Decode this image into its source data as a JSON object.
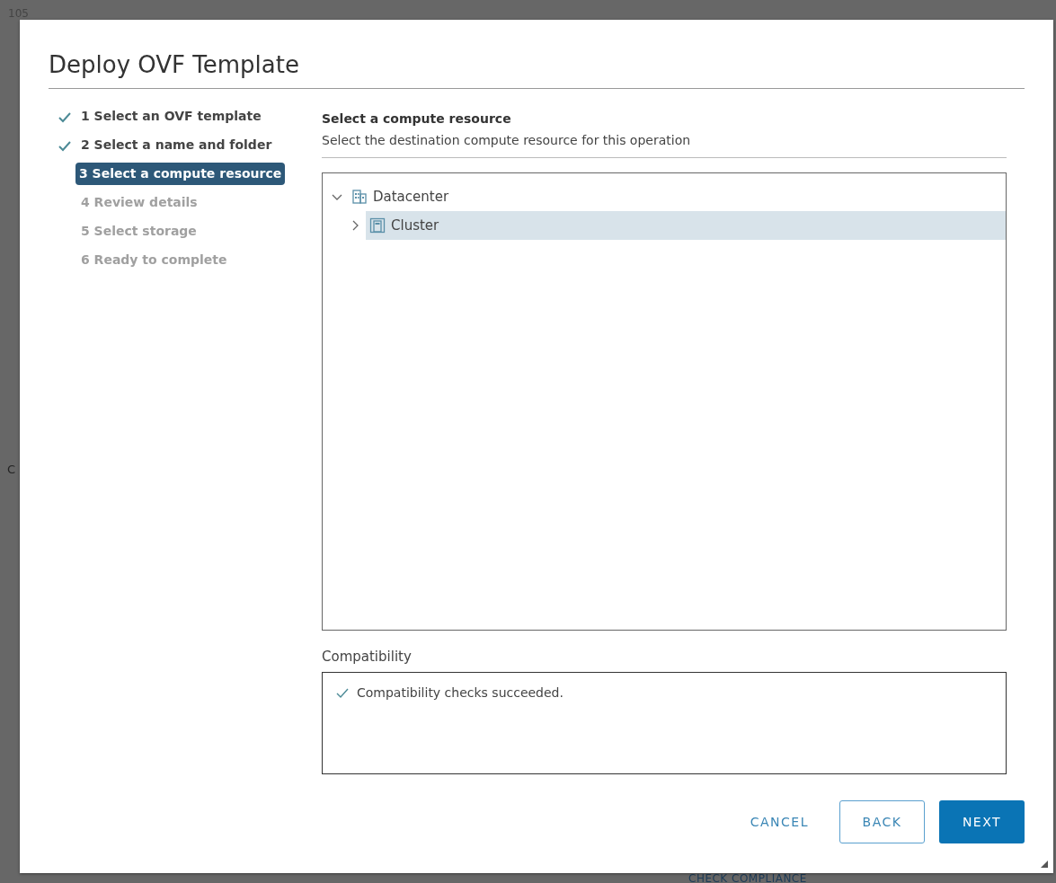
{
  "backdrop": {
    "texts": [
      {
        "text": "105",
        "kind": "top"
      },
      {
        "text": "C",
        "kind": "side"
      },
      {
        "text": "CHECK COMPLIANCE",
        "kind": "bottom"
      }
    ]
  },
  "dialog": {
    "title": "Deploy OVF Template",
    "steps": [
      {
        "label": "1 Select an OVF template",
        "completed": true,
        "selected": false
      },
      {
        "label": "2 Select a name and folder",
        "completed": true,
        "selected": false
      },
      {
        "label": "3 Select a compute resource",
        "completed": false,
        "selected": true
      },
      {
        "label": "4 Review details",
        "completed": false,
        "selected": false
      },
      {
        "label": "5 Select storage",
        "completed": false,
        "selected": false
      },
      {
        "label": "6 Ready to complete",
        "completed": false,
        "selected": false
      }
    ],
    "heading": "Select a compute resource",
    "subheading": "Select the destination compute resource for this operation",
    "tree": [
      {
        "label": "Datacenter",
        "kind": "datacenter",
        "expanded": true,
        "selected": false,
        "children": [
          {
            "label": "Cluster",
            "kind": "cluster",
            "expanded": false,
            "selected": true
          }
        ]
      }
    ],
    "compatibility": {
      "label": "Compatibility",
      "messages": [
        {
          "text": "Compatibility checks succeeded.",
          "kind": "success"
        }
      ]
    },
    "buttons": [
      {
        "label": "CANCEL",
        "kind": "link"
      },
      {
        "label": "BACK",
        "kind": "outline"
      },
      {
        "label": "NEXT",
        "kind": "primary"
      }
    ]
  }
}
